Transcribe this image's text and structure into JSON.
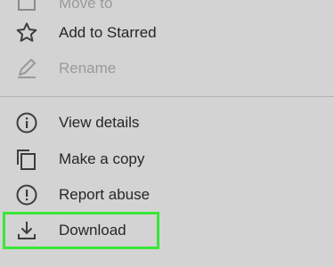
{
  "menu": {
    "items": [
      {
        "label": "Move to",
        "icon": "folder-move-icon",
        "state": "partially-visible"
      },
      {
        "label": "Add to Starred",
        "icon": "star-outline-icon",
        "state": "enabled"
      },
      {
        "label": "Rename",
        "icon": "pencil-icon",
        "state": "disabled"
      },
      {
        "label": "View details",
        "icon": "info-circle-icon",
        "state": "enabled"
      },
      {
        "label": "Make a copy",
        "icon": "copy-icon",
        "state": "enabled"
      },
      {
        "label": "Report abuse",
        "icon": "exclamation-circle-icon",
        "state": "enabled"
      },
      {
        "label": "Download",
        "icon": "download-icon",
        "state": "highlighted"
      }
    ]
  },
  "colors": {
    "background": "#d3d3d3",
    "text": "#262626",
    "icon": "#3c3c3c",
    "disabled": "#9a9a9a",
    "divider": "#b3b3b3",
    "highlight": "#39e639"
  }
}
